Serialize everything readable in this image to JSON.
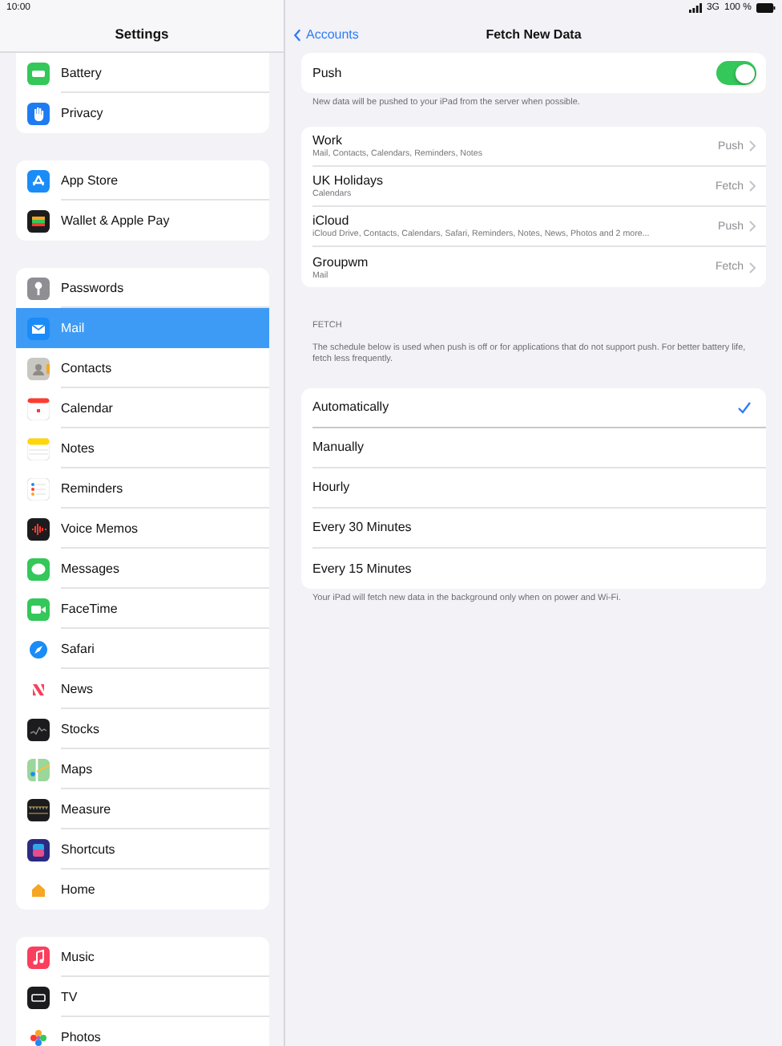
{
  "status_bar": {
    "time": "10:00",
    "network": "3G",
    "battery": "100 %"
  },
  "sidebar": {
    "title": "Settings",
    "groups": [
      {
        "cut_top": true,
        "items": [
          {
            "label": "Battery",
            "selected": false
          },
          {
            "label": "Privacy",
            "selected": false
          }
        ]
      },
      {
        "cut_top": false,
        "items": [
          {
            "label": "App Store",
            "selected": false
          },
          {
            "label": "Wallet & Apple Pay",
            "selected": false
          }
        ]
      },
      {
        "cut_top": false,
        "items": [
          {
            "label": "Passwords",
            "selected": false
          },
          {
            "label": "Mail",
            "selected": true
          },
          {
            "label": "Contacts",
            "selected": false
          },
          {
            "label": "Calendar",
            "selected": false
          },
          {
            "label": "Notes",
            "selected": false
          },
          {
            "label": "Reminders",
            "selected": false
          },
          {
            "label": "Voice Memos",
            "selected": false
          },
          {
            "label": "Messages",
            "selected": false
          },
          {
            "label": "FaceTime",
            "selected": false
          },
          {
            "label": "Safari",
            "selected": false
          },
          {
            "label": "News",
            "selected": false
          },
          {
            "label": "Stocks",
            "selected": false
          },
          {
            "label": "Maps",
            "selected": false
          },
          {
            "label": "Measure",
            "selected": false
          },
          {
            "label": "Shortcuts",
            "selected": false
          },
          {
            "label": "Home",
            "selected": false
          }
        ]
      },
      {
        "cut_top": false,
        "items": [
          {
            "label": "Music",
            "selected": false
          },
          {
            "label": "TV",
            "selected": false
          },
          {
            "label": "Photos",
            "selected": false
          }
        ]
      }
    ]
  },
  "detail": {
    "back": "Accounts",
    "title": "Fetch New Data",
    "push": {
      "label": "Push",
      "on": true,
      "footer": "New data will be pushed to your iPad from the server when possible."
    },
    "accounts": [
      {
        "name": "Work",
        "services": "Mail, Contacts, Calendars, Reminders, Notes",
        "mode": "Push"
      },
      {
        "name": "UK Holidays",
        "services": "Calendars",
        "mode": "Fetch"
      },
      {
        "name": "iCloud",
        "services": "iCloud Drive, Contacts, Calendars, Safari, Reminders, Notes, News, Photos and 2 more...",
        "mode": "Push"
      },
      {
        "name": "Groupwm",
        "services": "Mail",
        "mode": "Fetch"
      }
    ],
    "fetch_header": "FETCH",
    "fetch_description": "The schedule below is used when push is off or for applications that do not support push. For better battery life, fetch less frequently.",
    "options": [
      {
        "label": "Automatically",
        "selected": true
      },
      {
        "label": "Manually",
        "selected": false
      },
      {
        "label": "Hourly",
        "selected": false
      },
      {
        "label": "Every 30 Minutes",
        "selected": false
      },
      {
        "label": "Every 15 Minutes",
        "selected": false
      }
    ],
    "options_footer": "Your iPad will fetch new data in the background only when on power and Wi-Fi."
  }
}
